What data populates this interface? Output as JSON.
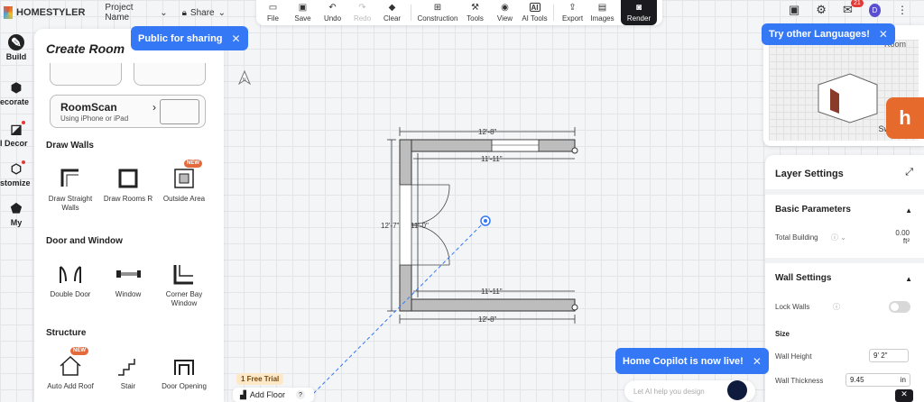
{
  "app": {
    "logo_text": "HOMESTYLER",
    "project_name": "Project Name",
    "share_label": "Share"
  },
  "toolbar": [
    {
      "label": "File",
      "icon": "folder-icon"
    },
    {
      "label": "Save",
      "icon": "save-icon"
    },
    {
      "label": "Undo",
      "icon": "undo-icon"
    },
    {
      "label": "Redo",
      "icon": "redo-icon",
      "disabled": true
    },
    {
      "label": "Clear",
      "icon": "eraser-icon"
    },
    {
      "label": "Construction",
      "icon": "construction-icon"
    },
    {
      "label": "Tools",
      "icon": "tools-icon"
    },
    {
      "label": "View",
      "icon": "eye-icon"
    },
    {
      "label": "AI Tools",
      "icon": "ai-icon"
    },
    {
      "label": "Export",
      "icon": "export-icon"
    },
    {
      "label": "Images",
      "icon": "images-icon"
    },
    {
      "label": "Render",
      "icon": "camera-icon"
    }
  ],
  "top_right": {
    "mail_badge": "21",
    "avatar_letter": "D"
  },
  "nav": [
    {
      "label": "Build",
      "icon": "build-icon"
    },
    {
      "label": "ecorate",
      "icon": "decorate-icon"
    },
    {
      "label": "I Decor",
      "icon": "ai-decor-icon"
    },
    {
      "label": "stomize",
      "icon": "customize-icon"
    },
    {
      "label": "My",
      "icon": "my-icon"
    }
  ],
  "panel": {
    "title": "Create Room",
    "roomscan": {
      "title": "RoomScan",
      "subtitle": "Using iPhone or iPad"
    },
    "sections": {
      "draw_walls": "Draw Walls",
      "door_window": "Door and Window",
      "structure": "Structure"
    },
    "draw_walls": [
      {
        "label": "Draw Straight Walls",
        "icon": "straight-wall-icon"
      },
      {
        "label": "Draw Rooms R",
        "icon": "draw-room-icon"
      },
      {
        "label": "Outside Area",
        "icon": "outside-area-icon",
        "badge": "NEW"
      }
    ],
    "door_window": [
      {
        "label": "Double Door",
        "icon": "double-door-icon"
      },
      {
        "label": "Window",
        "icon": "window-icon"
      },
      {
        "label": "Corner Bay Window",
        "icon": "corner-bay-window-icon"
      }
    ],
    "structure": [
      {
        "label": "Auto Add Roof",
        "icon": "roof-icon",
        "badge": "NEW"
      },
      {
        "label": "Stair",
        "icon": "stair-icon"
      },
      {
        "label": "Door Opening",
        "icon": "door-opening-icon"
      }
    ]
  },
  "tooltips": {
    "share": "Public for sharing",
    "languages": "Try other Languages!",
    "copilot": "Home Copilot is now live!"
  },
  "plan": {
    "dim_top": "12'-8\"",
    "dim_inner_top": "11'-11\"",
    "dim_left": "12'-7\"",
    "dim_inner_left": "11'-0\"",
    "dim_inner_bottom": "11'-11\"",
    "dim_bottom": "12'-8\"",
    "compass": "N"
  },
  "preview": {
    "room_label": "Room",
    "switch_label": "Switch to"
  },
  "layer": {
    "title": "Layer Settings",
    "basic_title": "Basic Parameters",
    "total_building_label": "Total Building",
    "total_building_value": "0.00",
    "total_building_unit": "ft²",
    "wall_title": "Wall Settings",
    "lock_walls_label": "Lock Walls",
    "size_label": "Size",
    "wall_height_label": "Wall Height",
    "wall_height_value": "9' 2\"",
    "wall_thickness_label": "Wall Thickness",
    "wall_thickness_value": "9.45",
    "wall_thickness_unit": "in"
  },
  "bottom": {
    "trial": "1 Free Trial",
    "add_floor": "Add Floor",
    "ai_placeholder": "Let AI help you design"
  }
}
